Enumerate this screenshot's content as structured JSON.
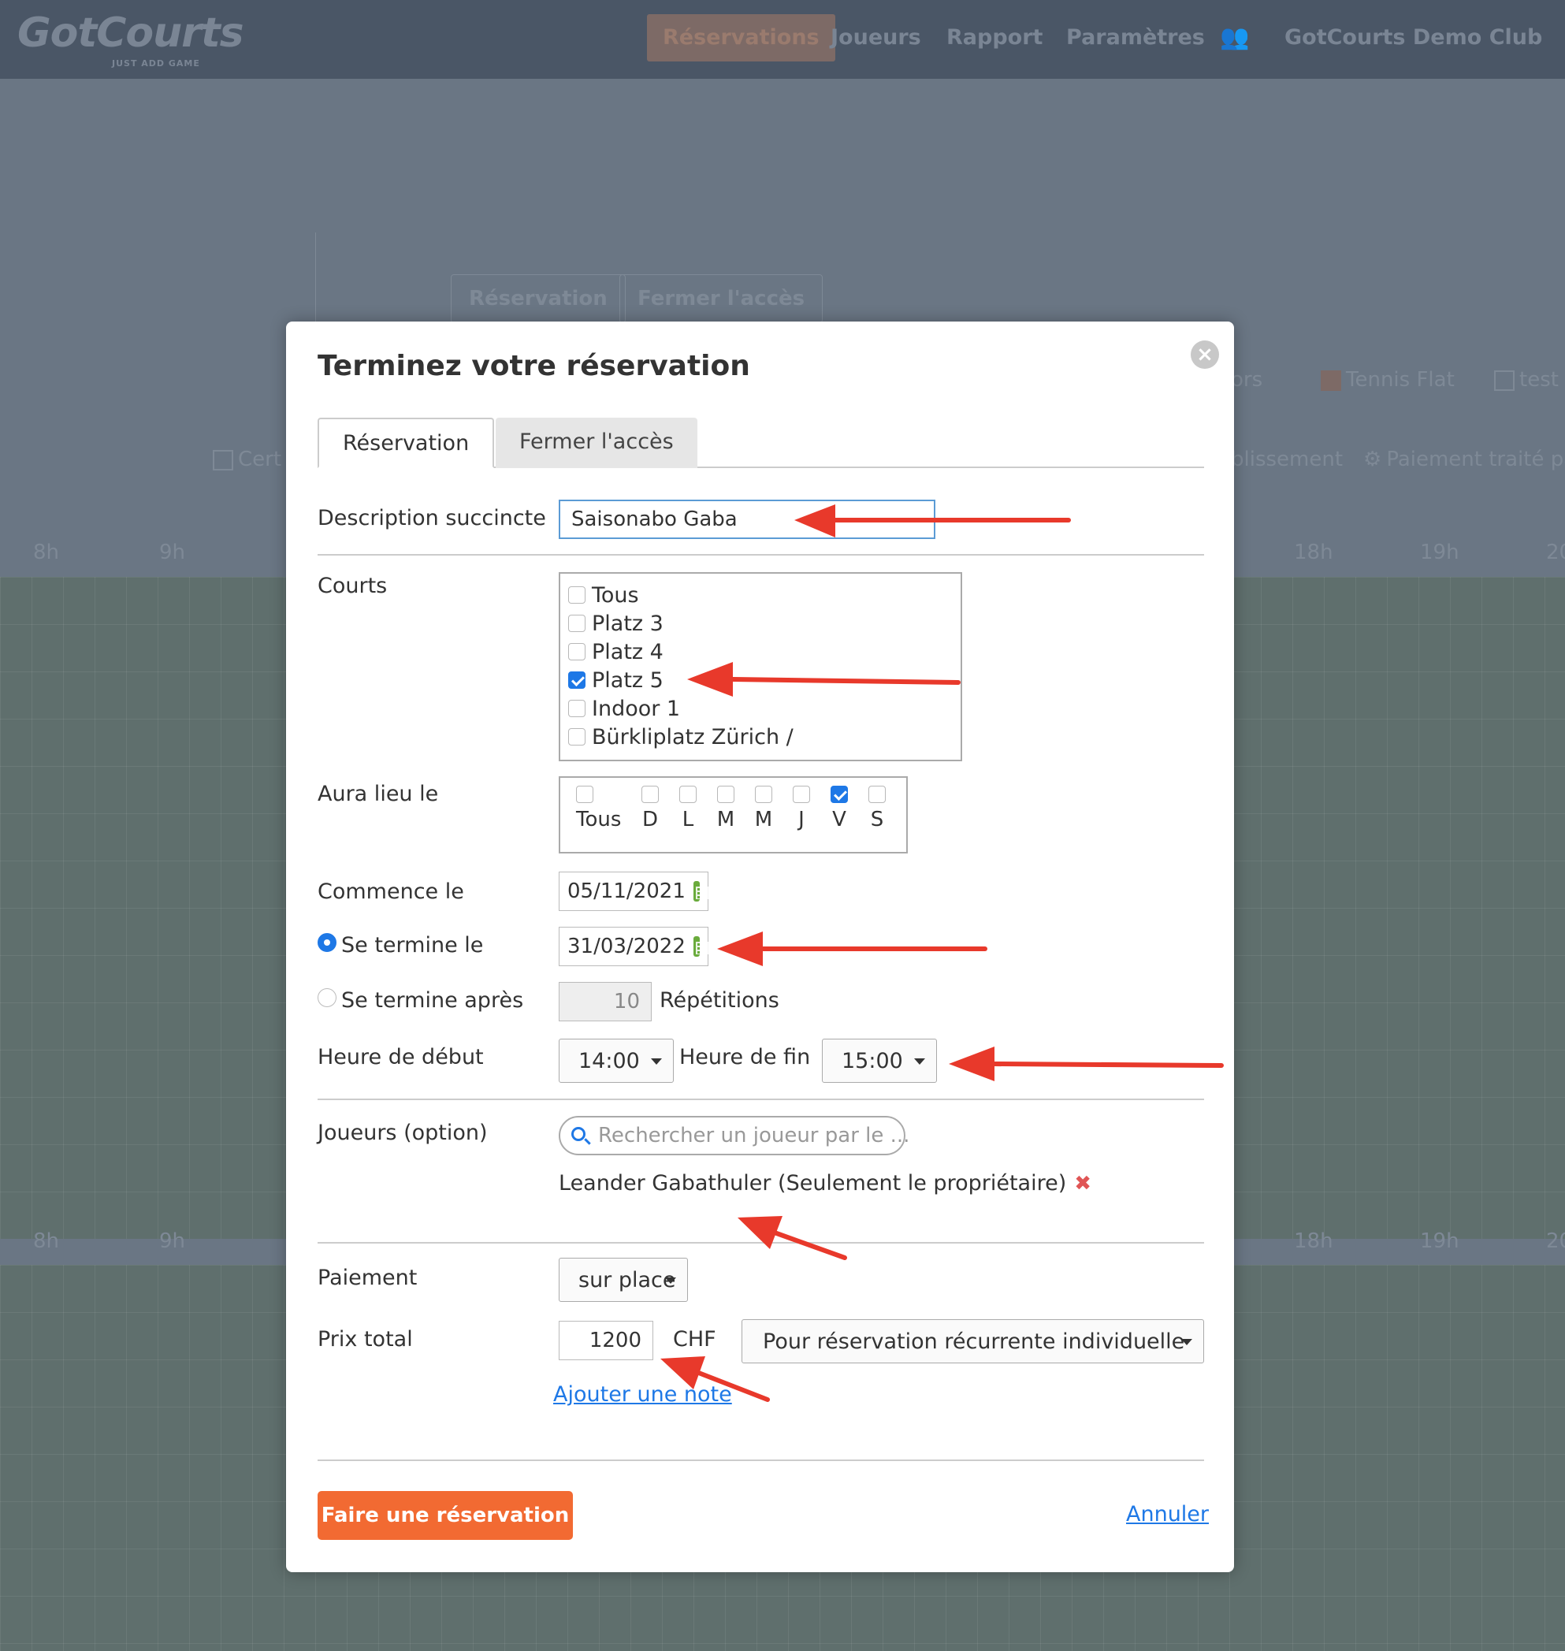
{
  "topbar": {
    "brand": "GotCourts",
    "tagline": "JUST ADD GAME",
    "nav": [
      "Réservations",
      "Joueurs",
      "Rapport",
      "Paramètres"
    ],
    "club": "GotCourts Demo Club"
  },
  "background": {
    "buttons": [
      "Réservation",
      "Fermer l'accès"
    ],
    "legend_top": [
      "ors",
      "Tennis Flat",
      "test"
    ],
    "legend_bottom": [
      "Cert",
      "blissement",
      "Paiement traité pa"
    ],
    "hours_left": [
      "8h",
      "9h"
    ],
    "hours_right": [
      "18h",
      "19h",
      "20"
    ]
  },
  "modal": {
    "title": "Terminez votre réservation",
    "tabs": [
      "Réservation",
      "Fermer l'accès"
    ],
    "description": {
      "label": "Description succincte",
      "value": "Saisonabo Gaba"
    },
    "courts": {
      "label": "Courts",
      "items": [
        {
          "name": "Tous",
          "checked": false
        },
        {
          "name": "Platz 3",
          "checked": false
        },
        {
          "name": "Platz 4",
          "checked": false
        },
        {
          "name": "Platz 5",
          "checked": true
        },
        {
          "name": "Indoor 1",
          "checked": false
        },
        {
          "name": "Bürkliplatz Zürich /",
          "checked": false
        }
      ]
    },
    "days": {
      "label": "Aura lieu le",
      "items": [
        {
          "name": "Tous",
          "checked": false
        },
        {
          "name": "D",
          "checked": false
        },
        {
          "name": "L",
          "checked": false
        },
        {
          "name": "M",
          "checked": false
        },
        {
          "name": "M",
          "checked": false
        },
        {
          "name": "J",
          "checked": false
        },
        {
          "name": "V",
          "checked": true
        },
        {
          "name": "S",
          "checked": false
        }
      ]
    },
    "start_date": {
      "label": "Commence le",
      "value": "05/11/2021"
    },
    "end_date": {
      "label": "Se termine le",
      "value": "31/03/2022",
      "selected": true
    },
    "end_after": {
      "label": "Se termine après",
      "value": "10",
      "unit": "Répétitions"
    },
    "start_time": {
      "label": "Heure de début",
      "value": "14:00"
    },
    "end_time": {
      "label": "Heure de fin",
      "value": "15:00"
    },
    "players": {
      "label": "Joueurs (option)",
      "placeholder": "Rechercher un joueur par le ...",
      "selected": "Leander Gabathuler (Seulement le propriétaire)"
    },
    "payment": {
      "label": "Paiement",
      "value": "sur place"
    },
    "price": {
      "label": "Prix total",
      "value": "1200",
      "currency": "CHF",
      "mode": "Pour réservation récurrente individuelle"
    },
    "add_note": "Ajouter une note",
    "submit": "Faire une réservation",
    "cancel": "Annuler"
  },
  "colors": {
    "accent": "#f26a32",
    "link": "#1e78e6",
    "annotation_arrow": "#e8392b"
  }
}
